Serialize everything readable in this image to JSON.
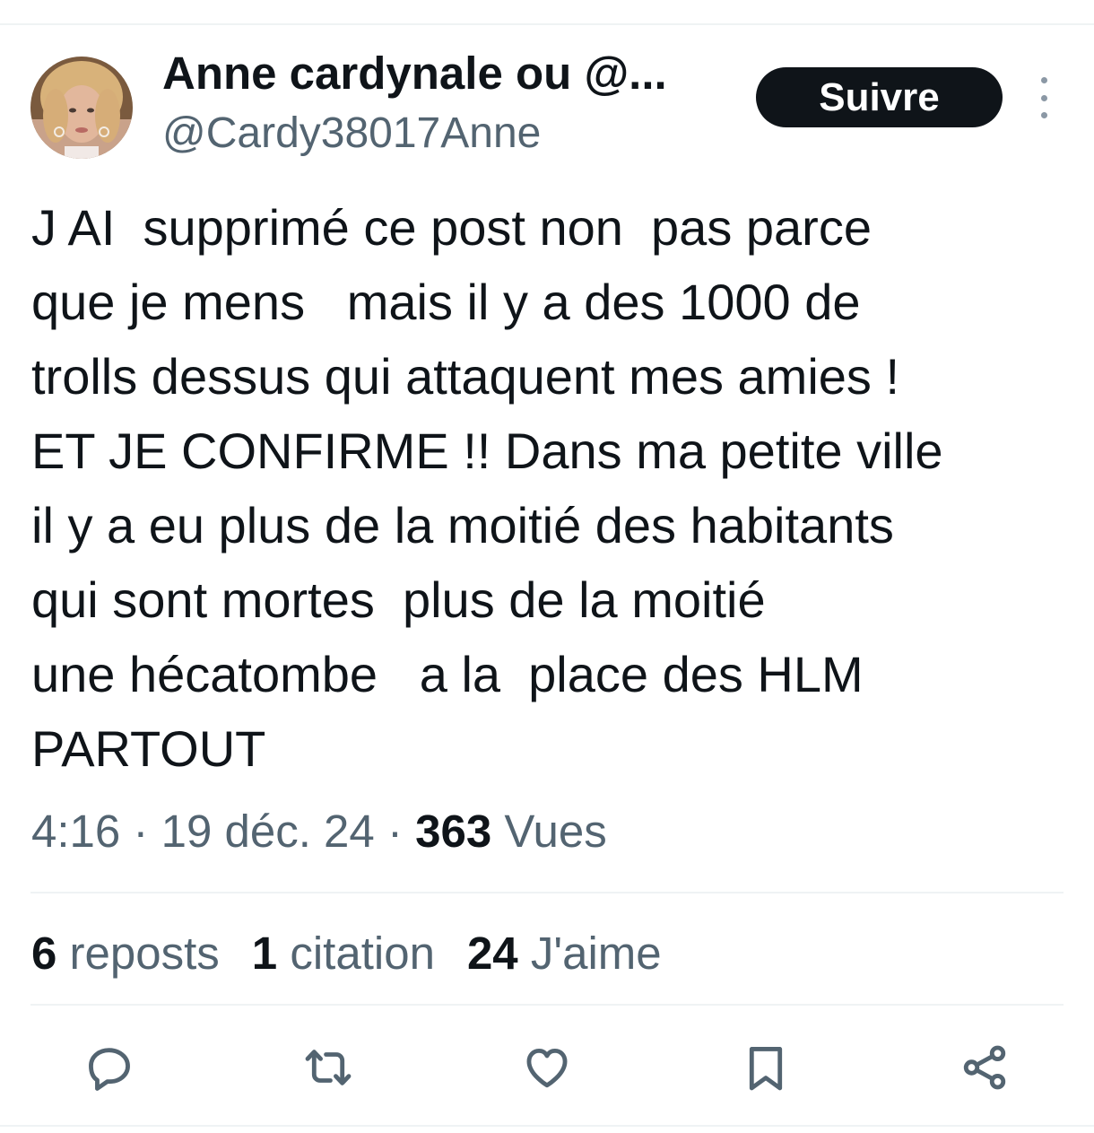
{
  "author": {
    "display_name": "Anne cardynale ou @...",
    "handle": "@Cardy38017Anne"
  },
  "follow_button": {
    "label": "Suivre"
  },
  "more_menu": {
    "icon": "more-vertical-icon"
  },
  "post": {
    "lines": [
      "J AI  supprimé ce post non  pas parce",
      "que je mens   mais il y a des 1000 de",
      "trolls dessus qui attaquent mes amies !",
      "ET JE CONFIRME !! Dans ma petite ville",
      "il y a eu plus de la moitié des habitants",
      "qui sont mortes  plus de la moitié",
      "une hécatombe   a la  place des HLM",
      "PARTOUT"
    ]
  },
  "meta": {
    "time": "4:16",
    "separator": " · ",
    "date": "19 déc. 24",
    "views_count": "363",
    "views_label": " Vues"
  },
  "stats": {
    "reposts_count": "6",
    "reposts_label": " reposts",
    "quotes_count": "1",
    "quotes_label": " citation",
    "likes_count": "24",
    "likes_label": " J'aime"
  },
  "actions": {
    "reply_icon": "reply-icon",
    "repost_icon": "repost-icon",
    "like_icon": "heart-icon",
    "bookmark_icon": "bookmark-icon",
    "share_icon": "share-icon"
  },
  "colors": {
    "text_primary": "#0f1419",
    "text_secondary": "#536471",
    "button_bg": "#0f1419",
    "divider": "#eff3f4"
  }
}
